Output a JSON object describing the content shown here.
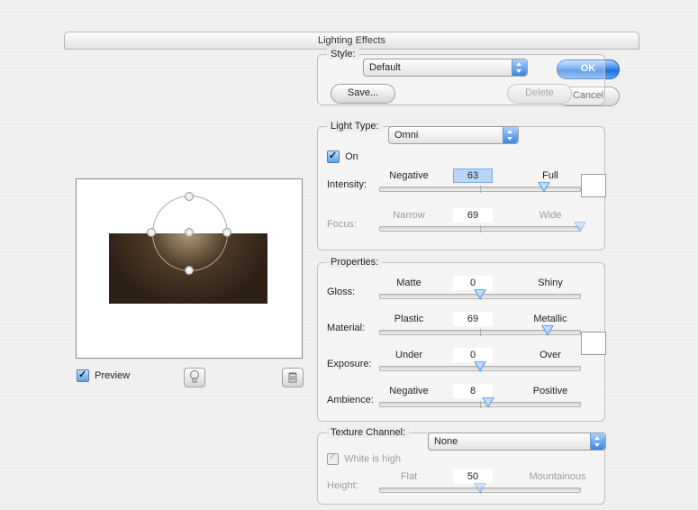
{
  "title": "Lighting Effects",
  "buttons": {
    "ok": "OK",
    "cancel": "Cancel",
    "save": "Save...",
    "delete": "Delete"
  },
  "style": {
    "label": "Style:",
    "value": "Default"
  },
  "preview": {
    "label": "Preview"
  },
  "light": {
    "group": "Light Type:",
    "value": "Omni",
    "on": "On",
    "intensity": {
      "label": "Intensity:",
      "left": "Negative",
      "right": "Full",
      "value": "63"
    },
    "focus": {
      "label": "Focus:",
      "left": "Narrow",
      "right": "Wide",
      "value": "69"
    }
  },
  "props": {
    "group": "Properties:",
    "gloss": {
      "label": "Gloss:",
      "left": "Matte",
      "right": "Shiny",
      "value": "0"
    },
    "material": {
      "label": "Material:",
      "left": "Plastic",
      "right": "Metallic",
      "value": "69"
    },
    "exposure": {
      "label": "Exposure:",
      "left": "Under",
      "right": "Over",
      "value": "0"
    },
    "ambience": {
      "label": "Ambience:",
      "left": "Negative",
      "right": "Positive",
      "value": "8"
    }
  },
  "texture": {
    "group": "Texture Channel:",
    "value": "None",
    "white_high": "White is high",
    "height": {
      "label": "Height:",
      "left": "Flat",
      "right": "Mountainous",
      "value": "50"
    }
  }
}
